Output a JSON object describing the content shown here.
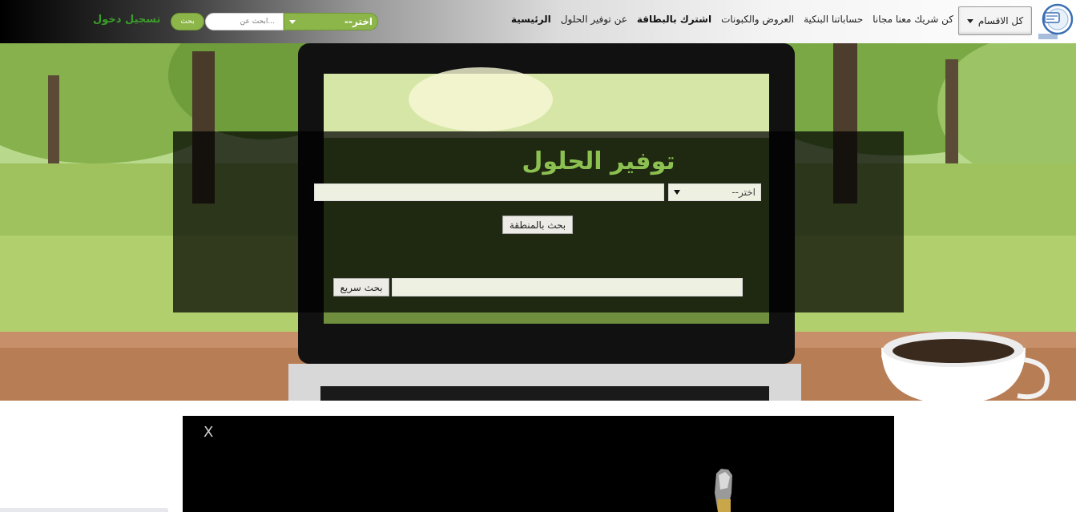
{
  "header": {
    "categories_label": "كل الاقسام",
    "nav": [
      {
        "label": "الرئيسية",
        "bold": true
      },
      {
        "label": "عن توفير الحلول",
        "bold": false
      },
      {
        "label": "اشترك بالبطاقة",
        "bold": true
      },
      {
        "label": "العروض والكبونات",
        "bold": false
      },
      {
        "label": "حساباتنا البنكية",
        "bold": false
      },
      {
        "label": "كن شريك معنا مجانا",
        "bold": false
      }
    ],
    "select_label": "اختر--",
    "search_placeholder": "...ابحث عن",
    "search_button": "بحث",
    "login_label": "تسجيل دخول"
  },
  "hero": {
    "title": "توفير الحلول",
    "select_label": "اختر--",
    "area_search_button": "بحث بالمنطقة",
    "quick_search_button": "بحث سريع"
  },
  "video": {
    "close_label": "X"
  },
  "colors": {
    "accent": "#8db64a",
    "title_green": "#8cc152",
    "login_green": "#3a9c2a"
  }
}
